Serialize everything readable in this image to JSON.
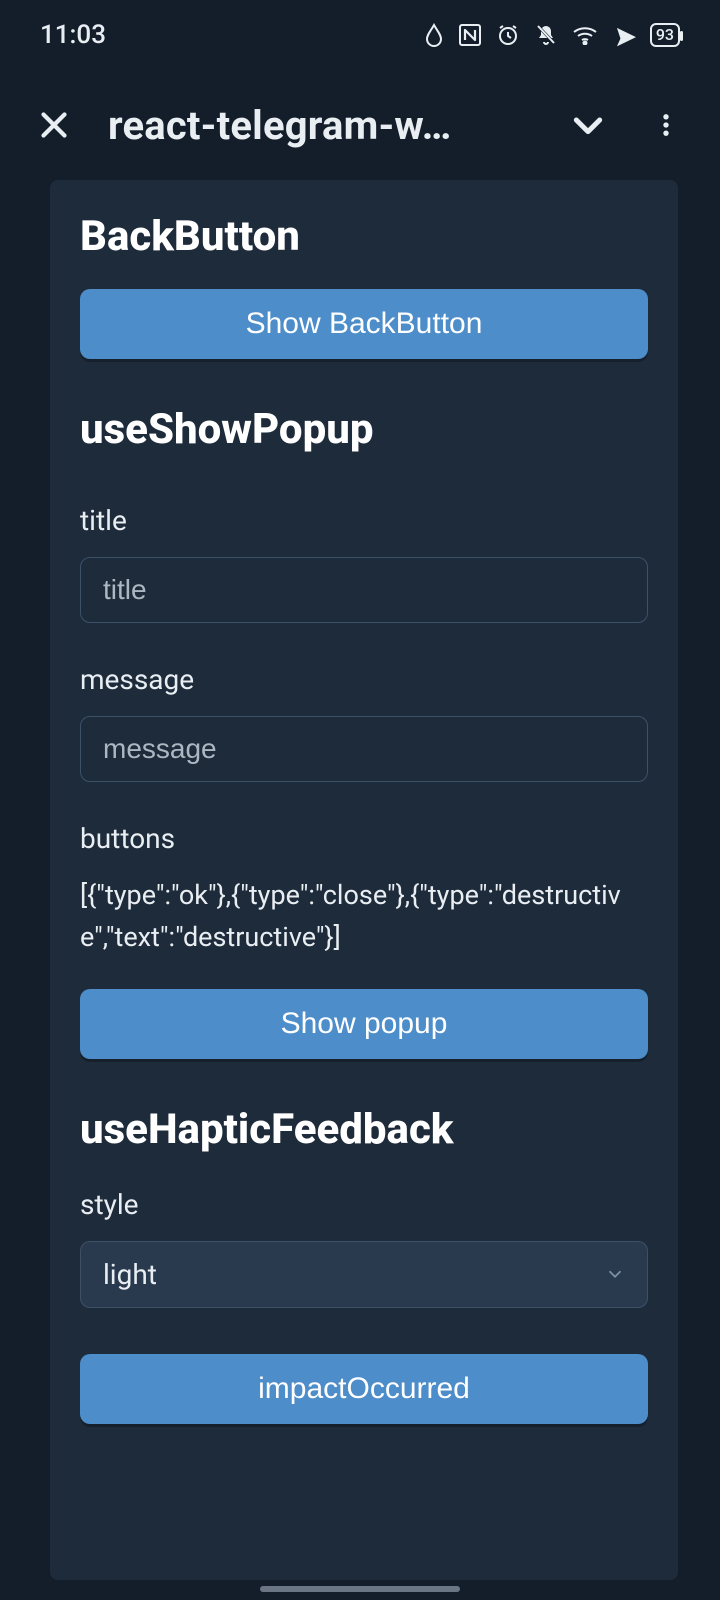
{
  "status": {
    "time": "11:03",
    "battery": "93"
  },
  "appbar": {
    "title": "react-telegram-w…"
  },
  "sections": {
    "backbutton": {
      "heading": "BackButton",
      "show_label": "Show BackButton"
    },
    "showpopup": {
      "heading": "useShowPopup",
      "title_label": "title",
      "title_placeholder": "title",
      "message_label": "message",
      "message_placeholder": "message",
      "buttons_label": "buttons",
      "buttons_value": "[{\"type\":\"ok\"},{\"type\":\"close\"},{\"type\":\"destructive\",\"text\":\"destructive\"}]",
      "show_label": "Show popup"
    },
    "haptic": {
      "heading": "useHapticFeedback",
      "style_label": "style",
      "style_value": "light",
      "impact_label": "impactOccurred"
    }
  }
}
